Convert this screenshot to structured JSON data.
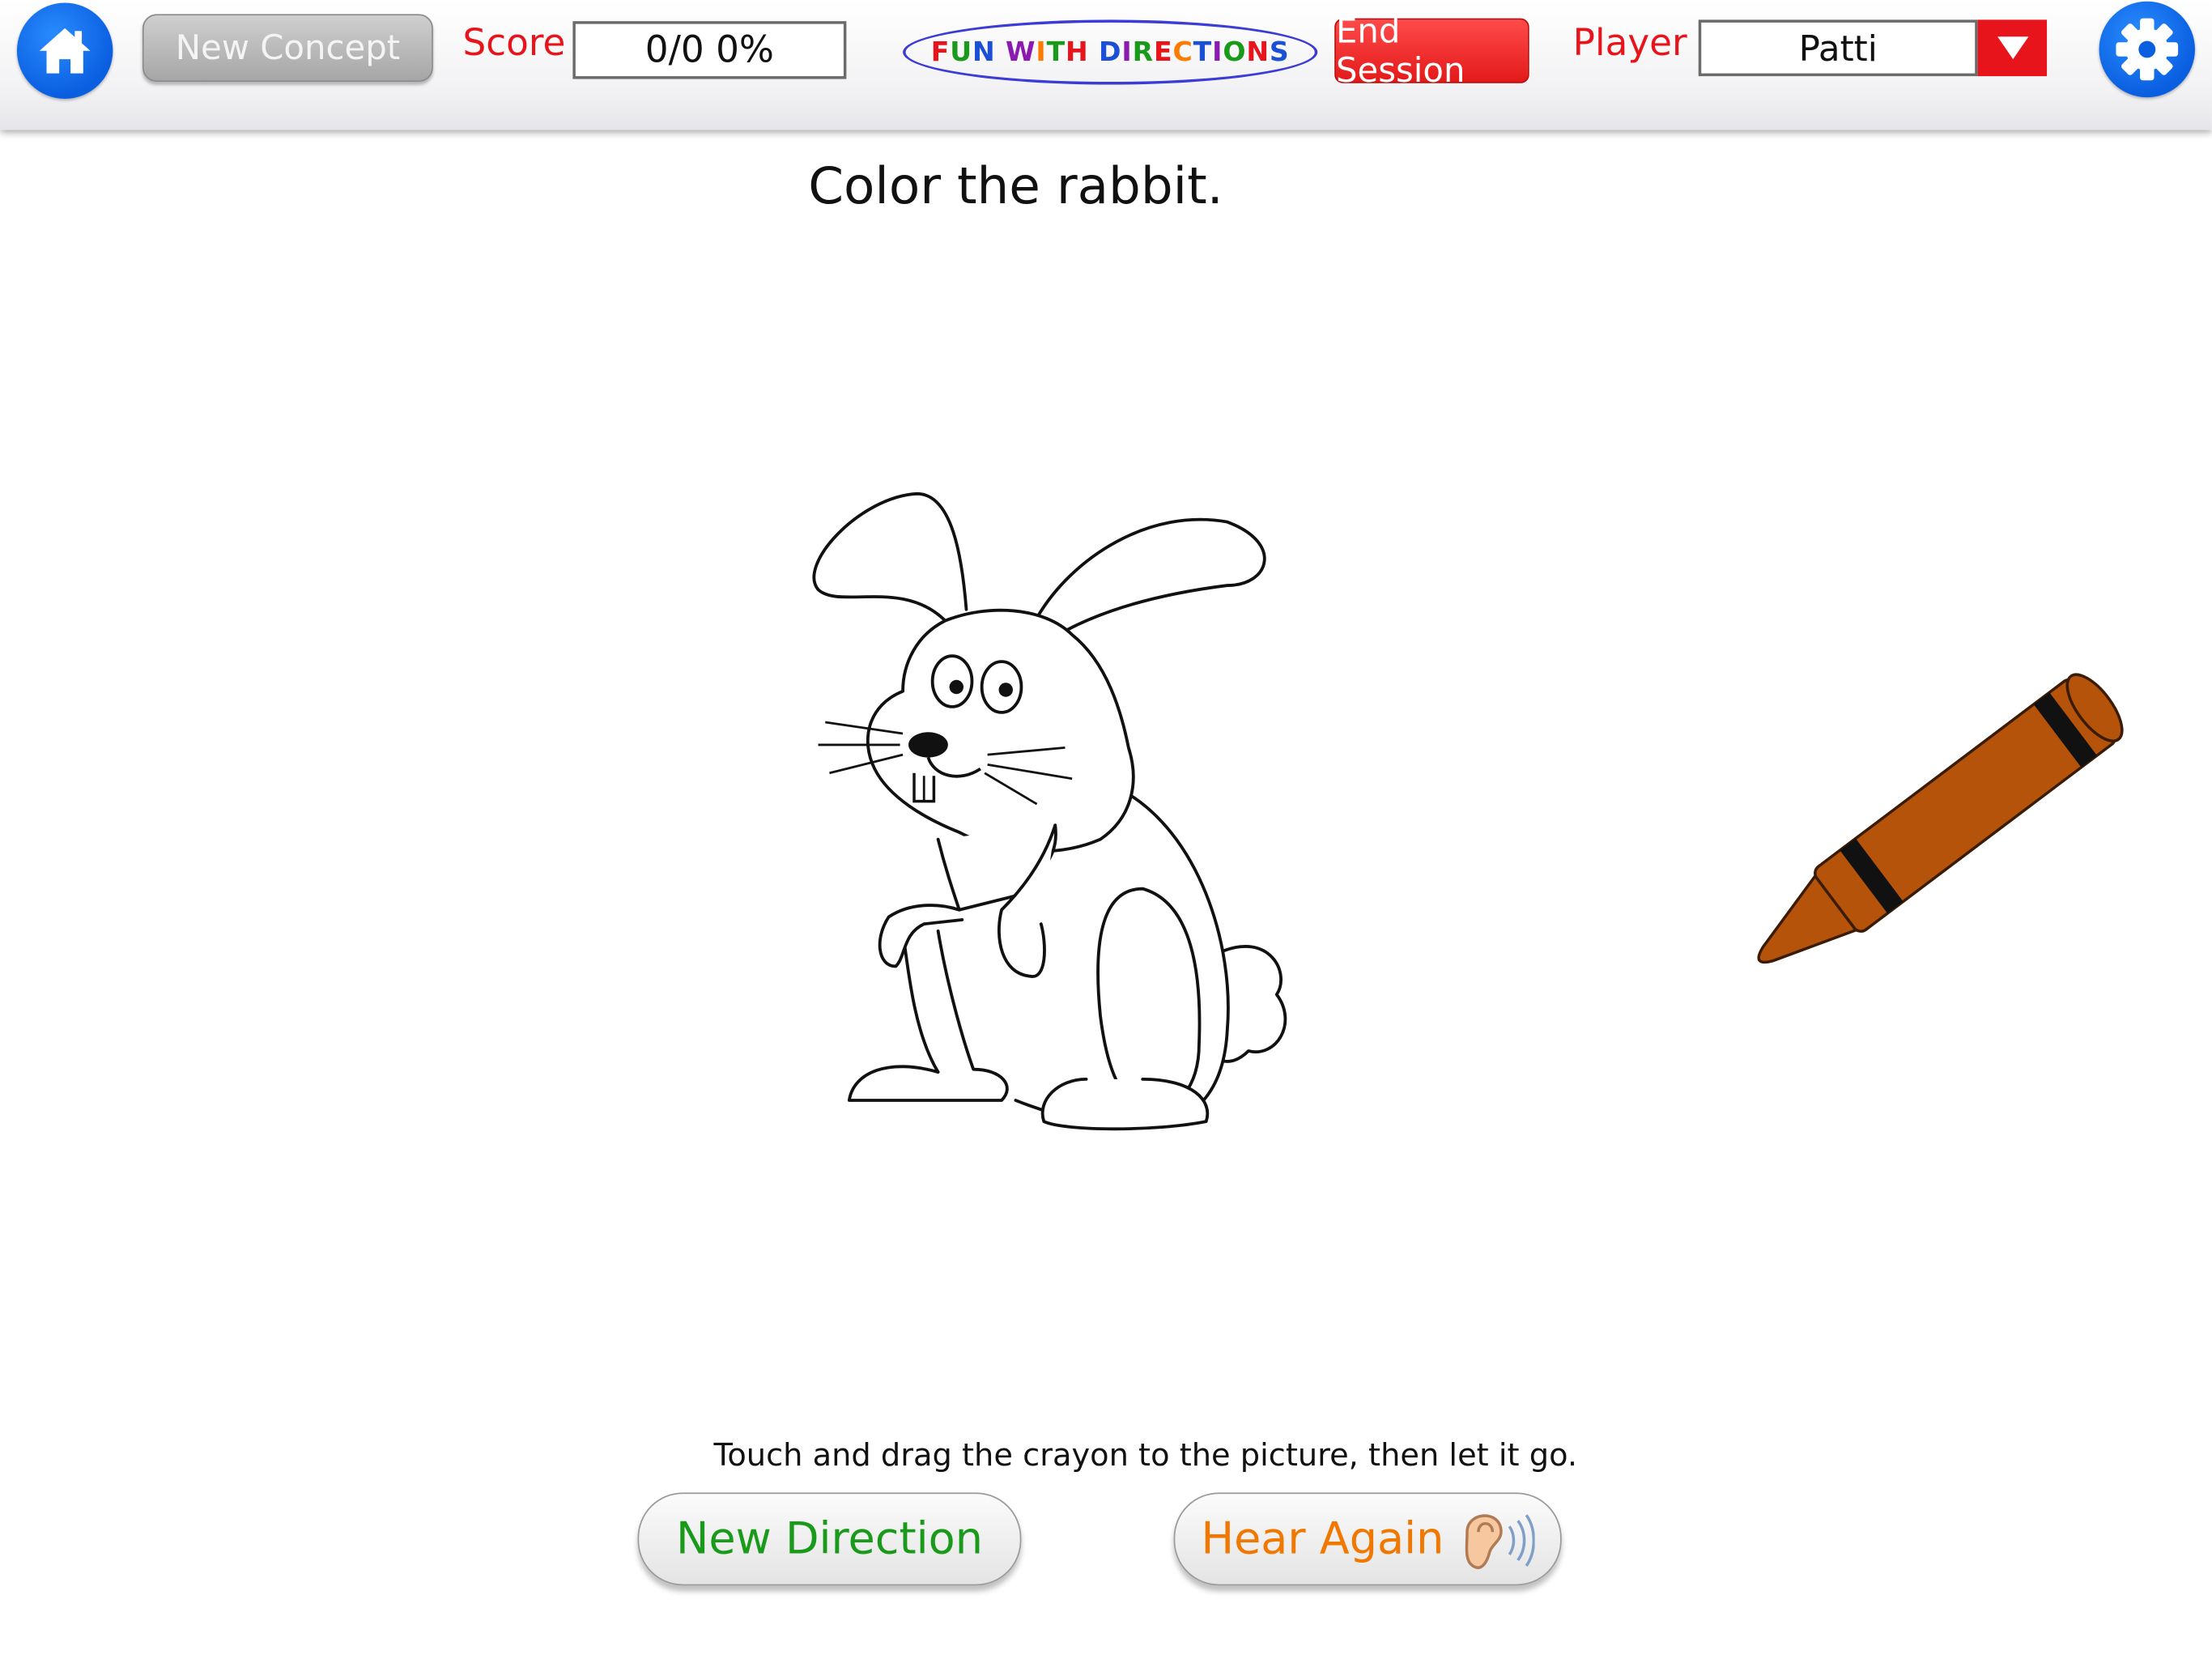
{
  "toolbar": {
    "home_icon": "home-icon",
    "new_concept_label": "New Concept",
    "score_label": "Score",
    "score_value": "0/0  0%",
    "app_title_letters": [
      {
        "ch": "F",
        "color": "#e8141c"
      },
      {
        "ch": "U",
        "color": "#1a9a1a"
      },
      {
        "ch": "N",
        "color": "#1a4fd6"
      },
      {
        "ch": " ",
        "color": "#000000"
      },
      {
        "ch": "W",
        "color": "#8b1ab0"
      },
      {
        "ch": "I",
        "color": "#ff7a00"
      },
      {
        "ch": "T",
        "color": "#1a9a1a"
      },
      {
        "ch": "H",
        "color": "#e8141c"
      },
      {
        "ch": " ",
        "color": "#000000"
      },
      {
        "ch": "D",
        "color": "#1a4fd6"
      },
      {
        "ch": "I",
        "color": "#8b1ab0"
      },
      {
        "ch": "R",
        "color": "#1a9a1a"
      },
      {
        "ch": "E",
        "color": "#e8141c"
      },
      {
        "ch": "C",
        "color": "#ff7a00"
      },
      {
        "ch": "T",
        "color": "#1a4fd6"
      },
      {
        "ch": "I",
        "color": "#8b1ab0"
      },
      {
        "ch": "O",
        "color": "#1a9a1a"
      },
      {
        "ch": "N",
        "color": "#e8141c"
      },
      {
        "ch": "S",
        "color": "#1a4fd6"
      }
    ],
    "end_session_label": "End Session",
    "player_label": "Player",
    "player_value": "Patti",
    "settings_icon": "gear-icon"
  },
  "main": {
    "instruction": "Color the rabbit.",
    "picture": "rabbit-outline",
    "crayon_color": "#b45309"
  },
  "footer": {
    "hint": "Touch and drag the crayon to the picture, then let it go.",
    "new_direction_label": "New Direction",
    "hear_again_label": "Hear Again",
    "ear_icon": "ear-icon"
  },
  "colors": {
    "accent_blue": "#0a5fe0",
    "red": "#e8141c",
    "green_text": "#1a9a1a",
    "orange_text": "#f07800"
  }
}
